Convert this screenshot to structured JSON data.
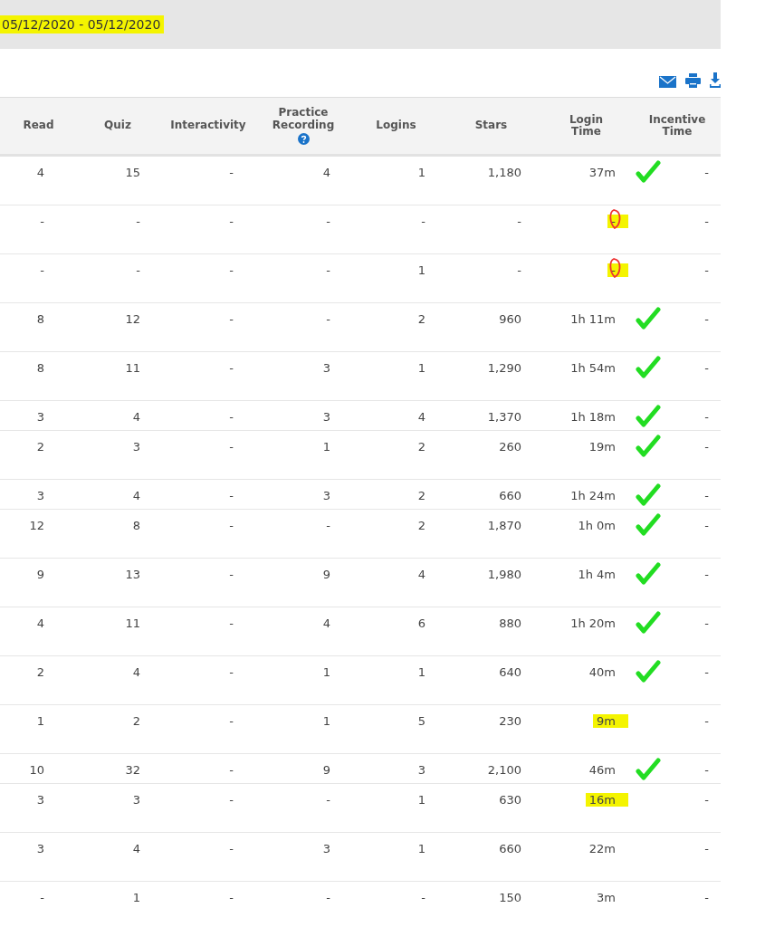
{
  "date_range": {
    "text": "05/12/2020 - 05/12/2020",
    "highlighted": true
  },
  "columns": [
    {
      "label": "Read"
    },
    {
      "label": "Quiz"
    },
    {
      "label": "Interactivity"
    },
    {
      "label": "Practice Recording",
      "help": true
    },
    {
      "label": "Logins"
    },
    {
      "label": "Stars"
    },
    {
      "label": "Login Time"
    },
    {
      "label": "Incentive Time"
    }
  ],
  "rows": [
    {
      "cells": [
        "4",
        "15",
        "-",
        "4",
        "1",
        "1,180",
        "37m",
        "-"
      ],
      "checked": true,
      "highlighted": false,
      "circled": false
    },
    {
      "cells": [
        "-",
        "-",
        "-",
        "-",
        "-",
        "-",
        "-",
        "-"
      ],
      "checked": false,
      "highlighted": true,
      "circled": true
    },
    {
      "cells": [
        "-",
        "-",
        "-",
        "-",
        "1",
        "-",
        "-",
        "-"
      ],
      "checked": false,
      "highlighted": true,
      "circled": true
    },
    {
      "cells": [
        "8",
        "12",
        "-",
        "-",
        "2",
        "960",
        "1h 11m",
        "-"
      ],
      "checked": true,
      "highlighted": false,
      "circled": false
    },
    {
      "cells": [
        "8",
        "11",
        "-",
        "3",
        "1",
        "1,290",
        "1h 54m",
        "-"
      ],
      "checked": true,
      "highlighted": false,
      "circled": false
    },
    {
      "cells": [
        "3",
        "4",
        "-",
        "3",
        "4",
        "1,370",
        "1h 18m",
        "-"
      ],
      "checked": true,
      "highlighted": false,
      "circled": false
    },
    {
      "cells": [
        "2",
        "3",
        "-",
        "1",
        "2",
        "260",
        "19m",
        "-"
      ],
      "checked": true,
      "highlighted": false,
      "circled": false
    },
    {
      "cells": [
        "3",
        "4",
        "-",
        "3",
        "2",
        "660",
        "1h 24m",
        "-"
      ],
      "checked": true,
      "highlighted": false,
      "circled": false
    },
    {
      "cells": [
        "12",
        "8",
        "-",
        "-",
        "2",
        "1,870",
        "1h 0m",
        "-"
      ],
      "checked": true,
      "highlighted": false,
      "circled": false
    },
    {
      "cells": [
        "9",
        "13",
        "-",
        "9",
        "4",
        "1,980",
        "1h 4m",
        "-"
      ],
      "checked": true,
      "highlighted": false,
      "circled": false
    },
    {
      "cells": [
        "4",
        "11",
        "-",
        "4",
        "6",
        "880",
        "1h 20m",
        "-"
      ],
      "checked": true,
      "highlighted": false,
      "circled": false
    },
    {
      "cells": [
        "2",
        "4",
        "-",
        "1",
        "1",
        "640",
        "40m",
        "-"
      ],
      "checked": true,
      "highlighted": false,
      "circled": false
    },
    {
      "cells": [
        "1",
        "2",
        "-",
        "1",
        "5",
        "230",
        "9m",
        "-"
      ],
      "checked": false,
      "highlighted": true,
      "circled": false
    },
    {
      "cells": [
        "10",
        "32",
        "-",
        "9",
        "3",
        "2,100",
        "46m",
        "-"
      ],
      "checked": true,
      "highlighted": false,
      "circled": false
    },
    {
      "cells": [
        "3",
        "3",
        "-",
        "-",
        "1",
        "630",
        "16m",
        "-"
      ],
      "checked": false,
      "highlighted": true,
      "circled": false
    },
    {
      "cells": [
        "3",
        "4",
        "-",
        "3",
        "1",
        "660",
        "22m",
        "-"
      ],
      "checked": false,
      "highlighted": false,
      "circled": false
    },
    {
      "cells": [
        "-",
        "1",
        "-",
        "-",
        "-",
        "150",
        "3m",
        "-"
      ],
      "checked": false,
      "highlighted": false,
      "circled": false
    }
  ]
}
